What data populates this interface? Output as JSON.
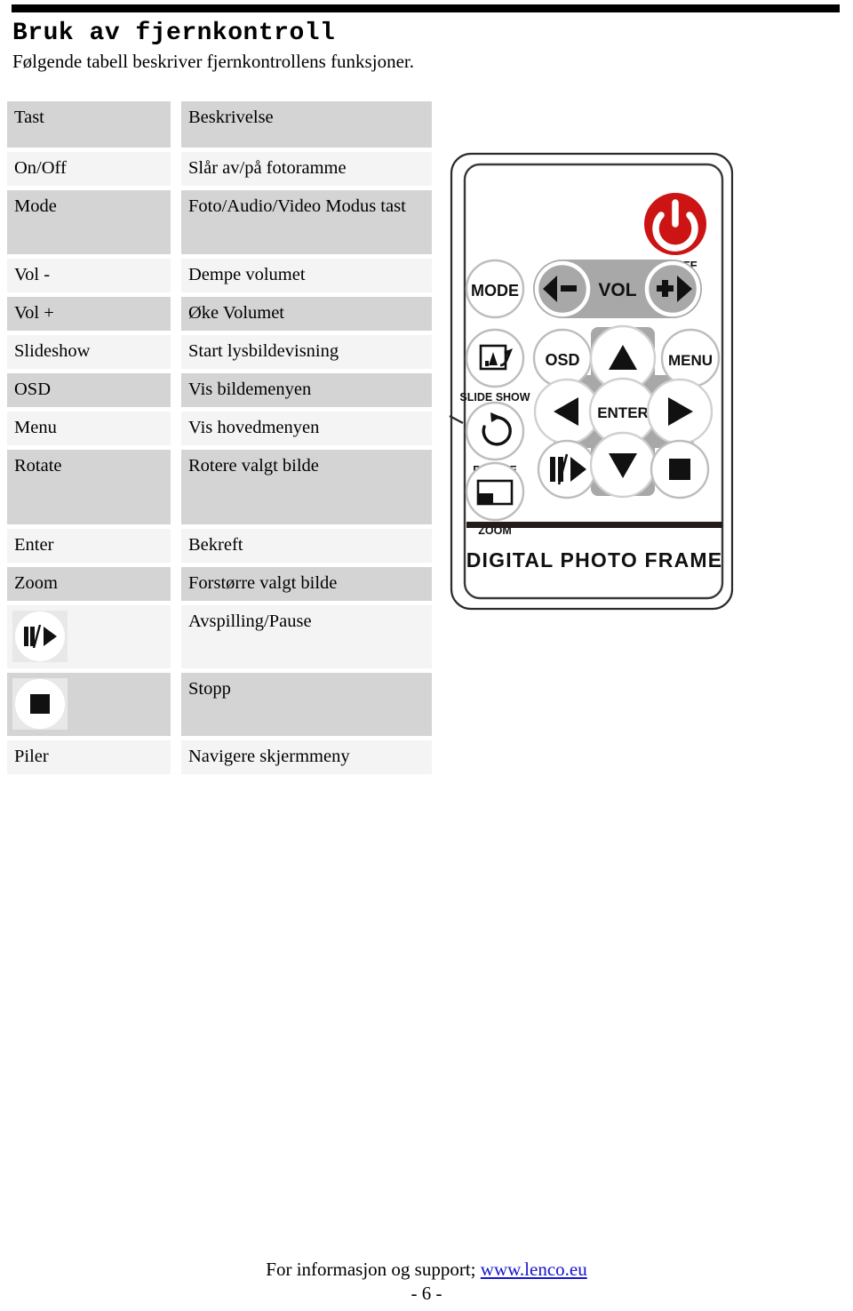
{
  "document": {
    "title": "Bruk av fjernkontroll",
    "subtitle": "Følgende tabell beskriver fjernkontrollens funksjoner."
  },
  "table": {
    "headers": {
      "key": "Tast",
      "description": "Beskrivelse"
    },
    "rows": [
      {
        "key": "On/Off",
        "key_type": "text",
        "description": "Slår av/på fotoramme"
      },
      {
        "key": "Mode",
        "key_type": "text",
        "description": "Foto/Audio/Video Modus tast"
      },
      {
        "key": "Vol -",
        "key_type": "text",
        "description": "Dempe volumet"
      },
      {
        "key": "Vol +",
        "key_type": "text",
        "description": "Øke Volumet"
      },
      {
        "key": "Slideshow",
        "key_type": "text",
        "description": "Start lysbildevisning"
      },
      {
        "key": "OSD",
        "key_type": "text",
        "description": "Vis bildemenyen"
      },
      {
        "key": "Menu",
        "key_type": "text",
        "description": "Vis hovedmenyen"
      },
      {
        "key": "Rotate",
        "key_type": "text",
        "description": "Rotere valgt bilde"
      },
      {
        "key": "Enter",
        "key_type": "text",
        "description": "Bekreft"
      },
      {
        "key": "Zoom",
        "key_type": "text",
        "description": "Forstørre valgt bilde"
      },
      {
        "key": "",
        "key_type": "icon",
        "key_icon": "play-pause-icon",
        "description": "Avspilling/Pause"
      },
      {
        "key": "",
        "key_type": "icon",
        "key_icon": "stop-icon",
        "description": "Stopp"
      },
      {
        "key": "Piler",
        "key_type": "text",
        "description": "Navigere skjermmeny"
      }
    ]
  },
  "remote": {
    "product_label": "DIGITAL PHOTO FRAME",
    "buttons": {
      "power_label": "ON/OFF",
      "mode": "MODE",
      "vol": "VOL",
      "vol_down_icon": "volume-down-icon",
      "vol_up_icon": "volume-up-icon",
      "slideshow_label": "SLIDE SHOW",
      "slideshow_icon": "slideshow-icon",
      "osd": "OSD",
      "menu": "MENU",
      "rotate_label": "ROTATE",
      "rotate_icon": "rotate-icon",
      "zoom_label": "ZOOM",
      "zoom_icon": "zoom-icon",
      "enter": "ENTER",
      "up_icon": "arrow-up-icon",
      "down_icon": "arrow-down-icon",
      "left_icon": "arrow-left-icon",
      "right_icon": "arrow-right-icon",
      "play_pause_icon": "play-pause-icon",
      "stop_icon": "stop-icon",
      "power_icon": "power-icon"
    }
  },
  "footer": {
    "text_prefix": "For informasjon og support; ",
    "link": "www.lenco.eu",
    "page_number": "- 6 -"
  },
  "colors": {
    "row_dark": "#d4d4d4",
    "row_light": "#f4f4f4",
    "power_red": "#cc1414",
    "remote_gray": "#a8a8a8",
    "link_blue": "#1414cc"
  }
}
